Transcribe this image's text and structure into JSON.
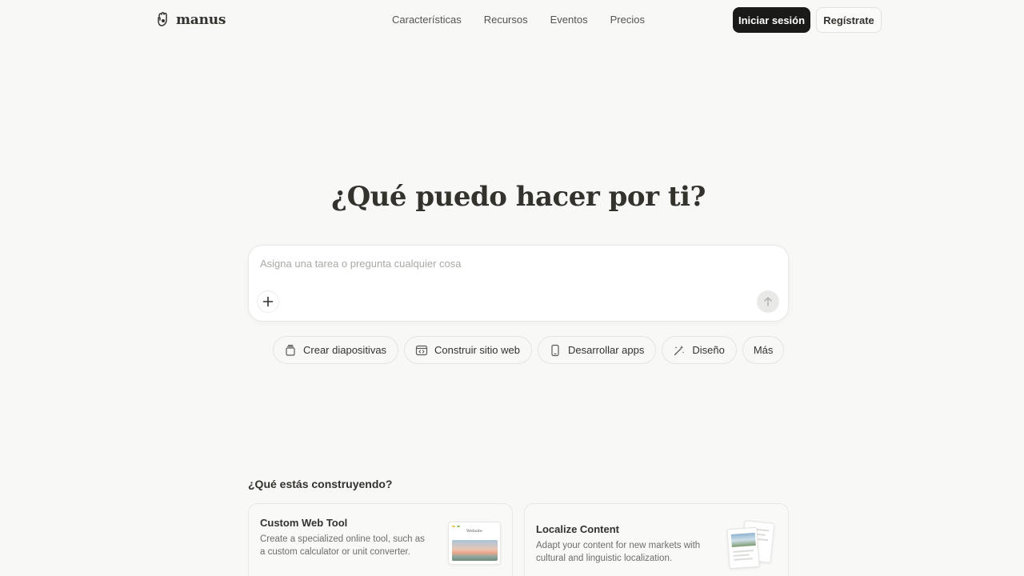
{
  "header": {
    "logo_text": "manus",
    "nav": [
      "Características",
      "Recursos",
      "Eventos",
      "Precios"
    ],
    "login_label": "Iniciar sesión",
    "signup_label": "Regístrate"
  },
  "hero": {
    "title": "¿Qué puedo hacer por ti?",
    "input_placeholder": "Asigna una tarea o pregunta cualquier cosa",
    "input_value": ""
  },
  "chips": [
    {
      "label": "Crear diapositivas",
      "icon": "slides-icon"
    },
    {
      "label": "Construir sitio web",
      "icon": "code-window-icon"
    },
    {
      "label": "Desarrollar apps",
      "icon": "mobile-icon"
    },
    {
      "label": "Diseño",
      "icon": "magic-wand-icon"
    },
    {
      "label": "Más",
      "icon": ""
    }
  ],
  "section": {
    "title": "¿Qué estás construyendo?",
    "cards": [
      {
        "title": "Custom Web Tool",
        "description": "Create a specialized online tool, such as a custom calculator or unit converter.",
        "thumbnail_title": "Website"
      },
      {
        "title": "Localize Content",
        "description": "Adapt your content for new markets with cultural and linguistic localization."
      }
    ]
  },
  "colors": {
    "background": "#f8f8f7",
    "primary_button": "#1a1a19",
    "text": "#34322d"
  }
}
